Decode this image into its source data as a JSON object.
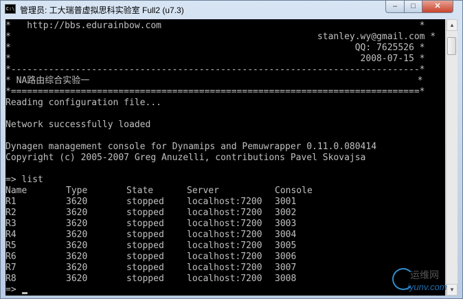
{
  "window": {
    "title": "管理员:  工大瑞普虚拟思科实验室 Full2 (u7.3)",
    "icon_label": "C:\\"
  },
  "controls": {
    "minimize": "–",
    "maximize": "□",
    "close": "✕"
  },
  "console": {
    "header": [
      "*   http://bbs.edurainbow.com                                                *",
      "*                                                         stanley.wy@gmail.com *",
      "*                                                                QQ: 7625526 *",
      "*                                                                 2008-07-15 *",
      "*----------------------------------------------------------------------------*",
      "* NA路由综合实验一                                                             *",
      "*============================================================================*"
    ],
    "messages": [
      "Reading configuration file...",
      "",
      "Network successfully loaded",
      "",
      "Dynagen management console for Dynamips and Pemuwrapper 0.11.0.080414",
      "Copyright (c) 2005-2007 Greg Anuzelli, contributions Pavel Skovajsa",
      "",
      "=> list"
    ],
    "table": {
      "headers": [
        "Name",
        "Type",
        "State",
        "Server",
        "Console"
      ],
      "rows": [
        [
          "R1",
          "3620",
          "stopped",
          "localhost:7200",
          "3001"
        ],
        [
          "R2",
          "3620",
          "stopped",
          "localhost:7200",
          "3002"
        ],
        [
          "R3",
          "3620",
          "stopped",
          "localhost:7200",
          "3003"
        ],
        [
          "R4",
          "3620",
          "stopped",
          "localhost:7200",
          "3004"
        ],
        [
          "R5",
          "3620",
          "stopped",
          "localhost:7200",
          "3005"
        ],
        [
          "R6",
          "3620",
          "stopped",
          "localhost:7200",
          "3006"
        ],
        [
          "R7",
          "3620",
          "stopped",
          "localhost:7200",
          "3007"
        ],
        [
          "R8",
          "3620",
          "stopped",
          "localhost:7200",
          "3008"
        ]
      ]
    },
    "prompt": "=>"
  },
  "watermark": {
    "line1": "运维网",
    "line2": "iyunv.com"
  }
}
